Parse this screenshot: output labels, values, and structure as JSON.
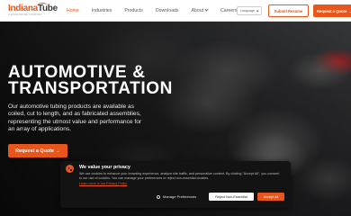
{
  "brand": {
    "logo_part1": "Indiana",
    "logo_part2": "Tube",
    "logo_tagline": "A WORLDWIDE COMPANY",
    "accent": "#e8561b"
  },
  "nav": {
    "items": [
      {
        "label": "Home",
        "active": true
      },
      {
        "label": "Industries"
      },
      {
        "label": "Products"
      },
      {
        "label": "Downloads"
      },
      {
        "label": "About",
        "has_dropdown": true
      },
      {
        "label": "Careers"
      }
    ],
    "language_label": "Language",
    "submit_resume_label": "Submit Resume",
    "request_quote_label": "Request a Quote →"
  },
  "hero": {
    "title_line1": "AUTOMOTIVE &",
    "title_line2": "TRANSPORTATION",
    "description": "Our automotive tubing products are available as coiled, cut to length, and as fabricated assemblies, representing the utmost value and performance for an array of applications.",
    "cta_label": "Request a Quote →"
  },
  "cookie_banner": {
    "title": "We value your privacy",
    "body": "We use cookies to enhance your browsing experience, analyze site traffic, and personalize content. By clicking \"Accept All\", you consent to our use of cookies. You can manage your preferences or reject non-essential cookies.",
    "link_label": "Learn more in our Privacy Policy",
    "manage_label": "Manage Preferences",
    "reject_label": "Reject Non-Essential",
    "accept_label": "Accept All"
  }
}
